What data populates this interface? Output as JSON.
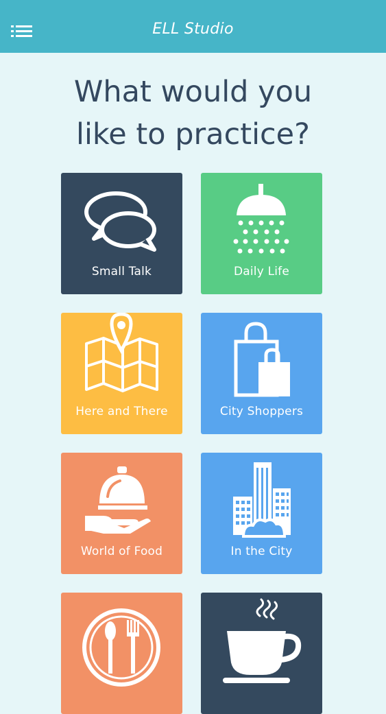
{
  "header": {
    "title": "ELL Studio",
    "menu_icon": "list-menu-icon"
  },
  "main": {
    "headline_line1": "What would you",
    "headline_line2": "like to practice?"
  },
  "tiles": [
    {
      "label": "Small Talk",
      "icon": "speech-bubbles-icon",
      "color": "#34495e"
    },
    {
      "label": "Daily Life",
      "icon": "shower-head-icon",
      "color": "#58cc85"
    },
    {
      "label": "Here and There",
      "icon": "map-pin-icon",
      "color": "#fdbd43"
    },
    {
      "label": "City Shoppers",
      "icon": "shopping-bags-icon",
      "color": "#58a5ee"
    },
    {
      "label": "World of Food",
      "icon": "serving-cloche-icon",
      "color": "#f29166"
    },
    {
      "label": "In the City",
      "icon": "city-buildings-icon",
      "color": "#58a5ee"
    },
    {
      "label": "",
      "icon": "fork-spoon-plate-icon",
      "color": "#f29166"
    },
    {
      "label": "",
      "icon": "coffee-cup-icon",
      "color": "#34495e"
    }
  ]
}
